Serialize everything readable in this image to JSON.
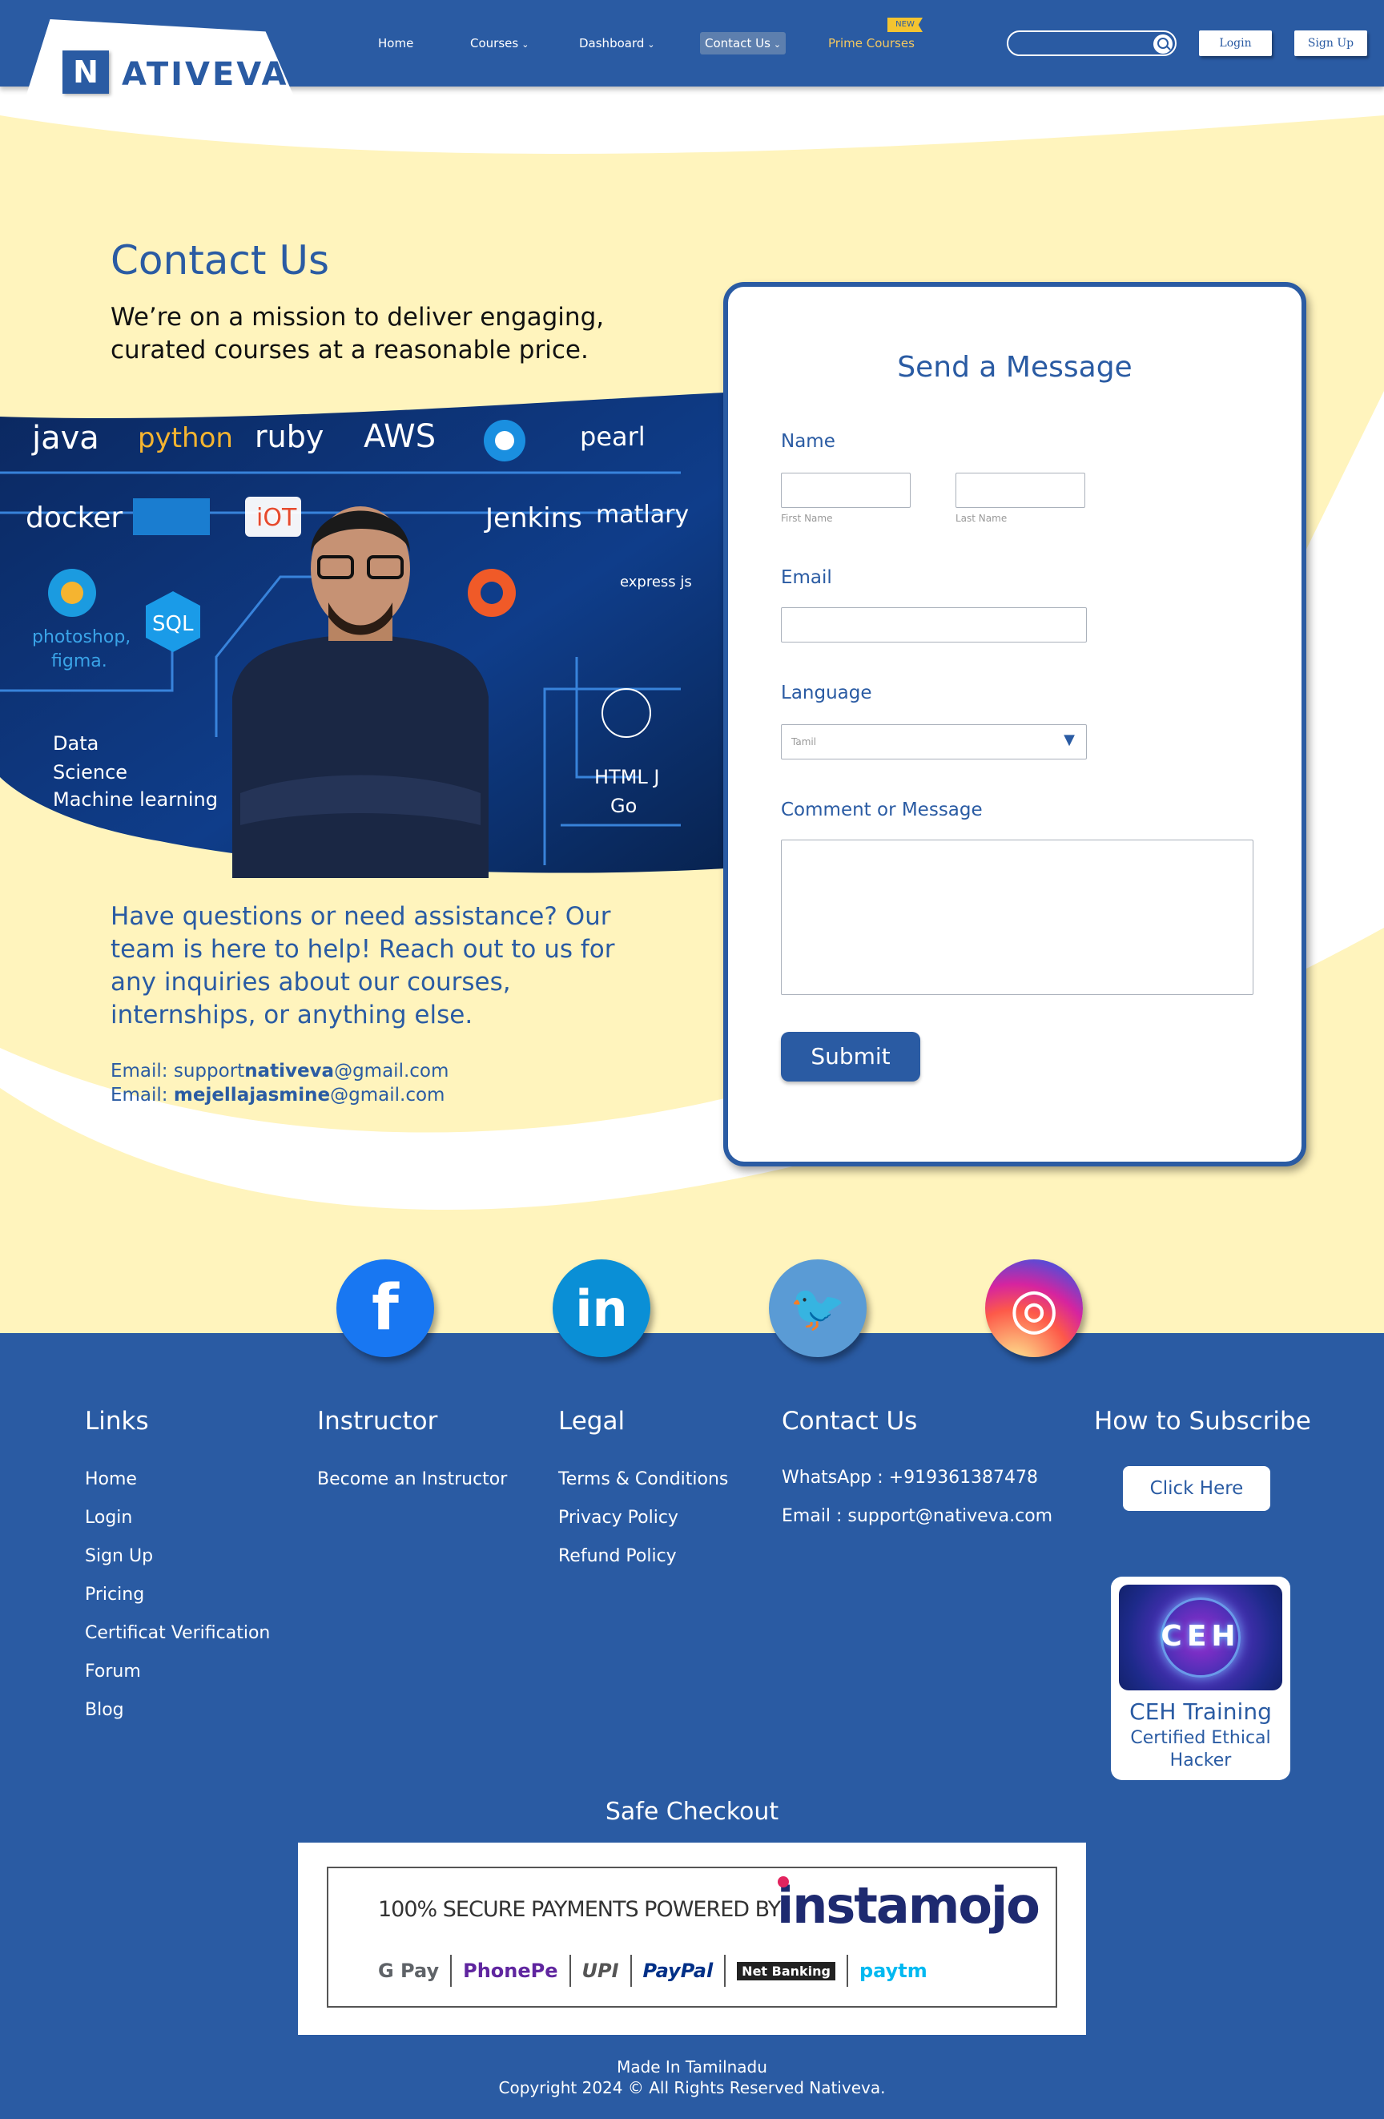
{
  "header": {
    "logo_letter": "N",
    "logo_text": "ATIVEVA",
    "nav": [
      {
        "label": "Home"
      },
      {
        "label": "Courses"
      },
      {
        "label": "Dashboard"
      },
      {
        "label": "Contact Us"
      },
      {
        "label": "Prime Courses"
      }
    ],
    "new_badge": "NEW",
    "search": {
      "value": "",
      "placeholder": ""
    },
    "login_label": "Login",
    "signup_label": "Sign Up"
  },
  "hero": {
    "title": "Contact Us",
    "subtitle": "We’re on a mission to deliver engaging, curated courses at a reasonable price.",
    "image_words": [
      "java",
      "python",
      "ruby",
      "AWS",
      "pearl",
      "docker",
      "jenkins",
      "iOT",
      "Jenkins",
      "matlary",
      "photoshop,",
      "figma.",
      "SQL",
      "express js",
      "Data",
      "Science",
      "Machine learning",
      "HTML J",
      "Go"
    ],
    "assist_text": "Have questions or need assistance? Our team is here to help! Reach out to us for any inquiries about our courses, internships, or anything else.",
    "emails": [
      {
        "prefix": "Email: support",
        "bold": "nativeva",
        "suffix": "@gmail.com"
      },
      {
        "prefix": "Email: ",
        "bold": "mejellajasmine",
        "suffix": "@gmail.com"
      }
    ]
  },
  "form": {
    "title": "Send a Message",
    "name_label": "Name",
    "first_name_hint": "First Name",
    "last_name_hint": "Last Name",
    "first_name_value": "",
    "last_name_value": "",
    "email_label": "Email",
    "email_value": "",
    "language_label": "Language",
    "language_value": "Tamil",
    "message_label": "Comment or Message",
    "message_value": "",
    "submit_label": "Submit"
  },
  "social": [
    {
      "name": "facebook",
      "glyph": "f",
      "color": "#1877f2"
    },
    {
      "name": "linkedin",
      "glyph": "in",
      "color": "#0a8fd6"
    },
    {
      "name": "twitter",
      "glyph": "🐦",
      "color": "#5a9bd5"
    },
    {
      "name": "instagram",
      "glyph": "◎",
      "color": "#d62976"
    }
  ],
  "footer": {
    "links_title": "Links",
    "links": [
      "Home",
      "Login",
      "Sign Up",
      "Pricing",
      "Certificat Verification",
      "Forum",
      "Blog"
    ],
    "instructor_title": "Instructor",
    "instructor_links": [
      "Become an Instructor"
    ],
    "legal_title": "Legal",
    "legal_links": [
      "Terms & Conditions",
      "Privacy Policy",
      "Refund Policy"
    ],
    "contact_title": "Contact Us",
    "contact_lines": [
      "WhatsApp : +919361387478",
      "Email : support@nativeva.com"
    ],
    "subscribe_title": "How to Subscribe",
    "click_here_label": "Click Here",
    "ceh": {
      "logo": "CEH",
      "title": "CEH Training",
      "subtitle": "Certified Ethical Hacker"
    },
    "safe_checkout_title": "Safe Checkout",
    "payment": {
      "secure_text": "100% SECURE PAYMENTS POWERED BY",
      "brand": "instamojo",
      "methods": [
        "G Pay",
        "PhonePe",
        "UPI",
        "PayPal",
        "Net Banking",
        "paytm"
      ]
    },
    "made_in": "Made In Tamilnadu",
    "copyright": "Copyright 2024 © All Rights Reserved Nativeva."
  },
  "colors": {
    "brand_blue": "#2a5ba3",
    "cream": "#fff4bd",
    "accent_gold": "#f4c430"
  }
}
